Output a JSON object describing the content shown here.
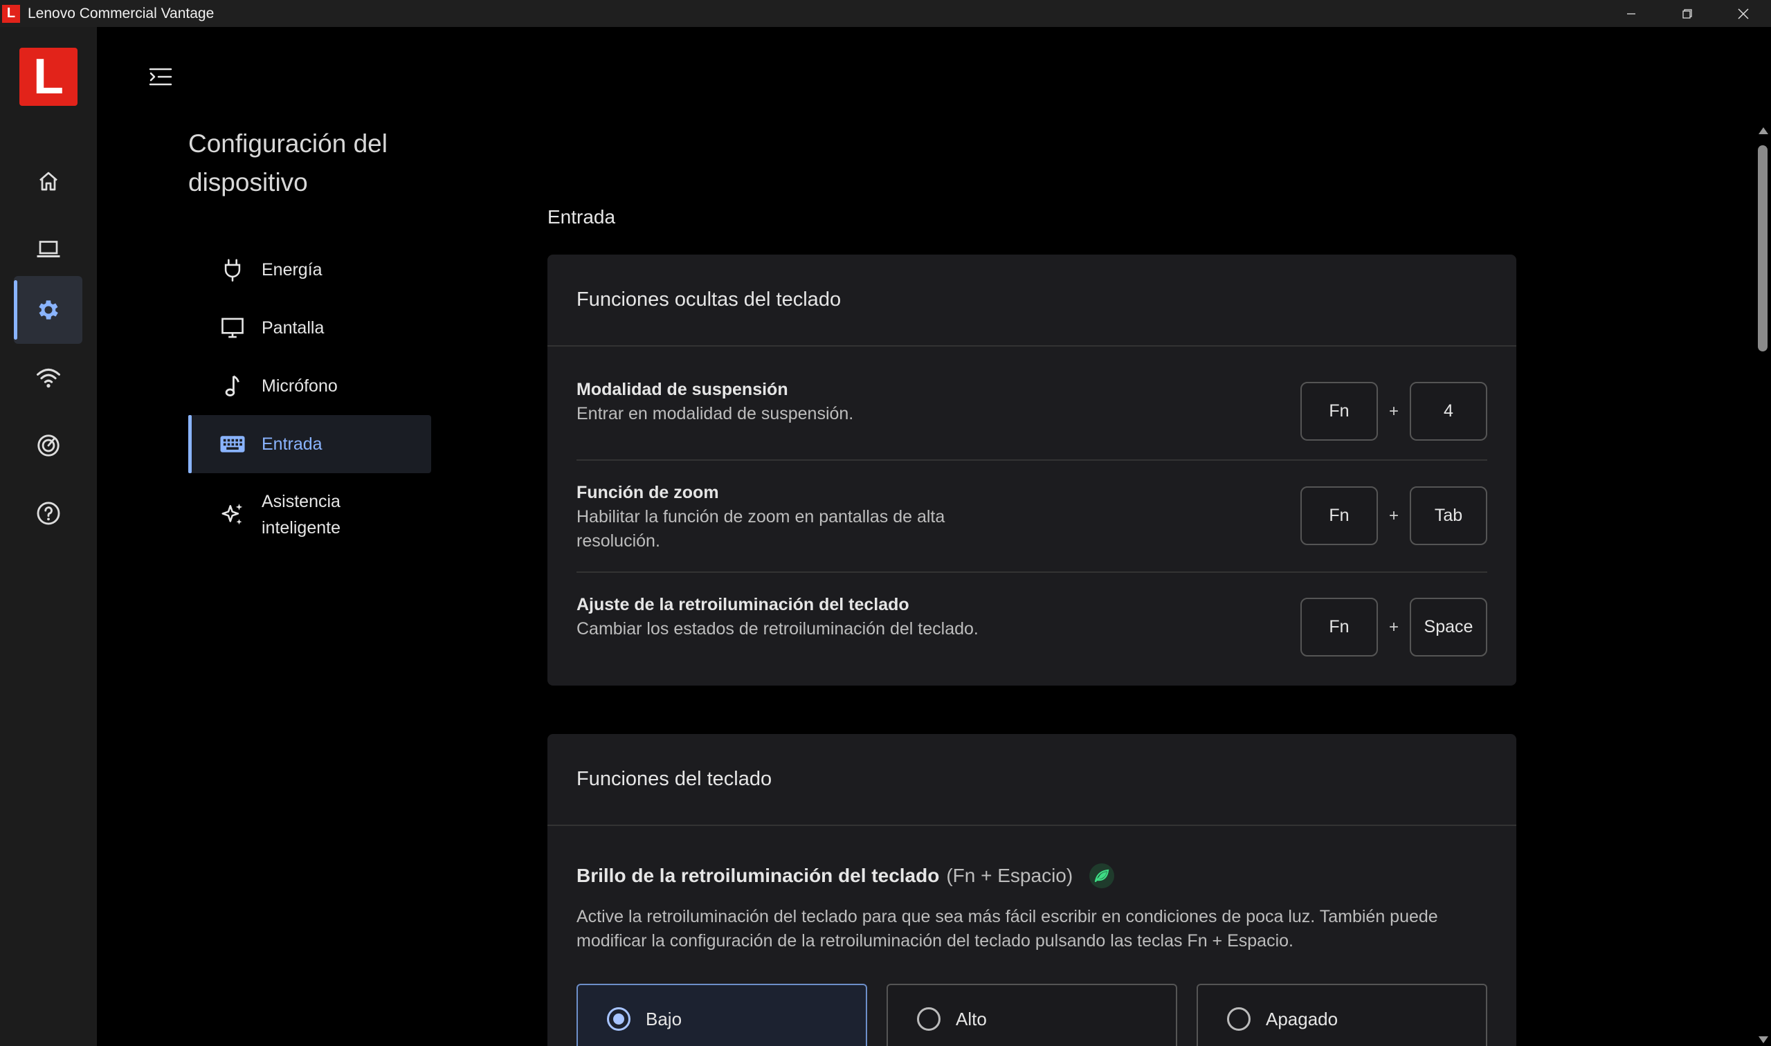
{
  "window": {
    "title": "Lenovo Commercial Vantage",
    "app_icon_letter": "L"
  },
  "rail": {
    "logo_letter": "L",
    "items": [
      {
        "icon": "home-icon"
      },
      {
        "icon": "laptop-icon"
      },
      {
        "icon": "gear-icon",
        "active": true
      },
      {
        "icon": "wifi-icon"
      },
      {
        "icon": "gauge-icon"
      },
      {
        "icon": "help-icon"
      }
    ]
  },
  "section": {
    "title": "Configuración del dispositivo"
  },
  "subnav": {
    "items": [
      {
        "label": "Energía",
        "icon": "plug-icon"
      },
      {
        "label": "Pantalla",
        "icon": "monitor-icon"
      },
      {
        "label": "Micrófono",
        "icon": "music-note-icon"
      },
      {
        "label": "Entrada",
        "icon": "keyboard-icon",
        "active": true
      },
      {
        "label": "Asistencia inteligente",
        "icon": "sparkle-icon"
      }
    ]
  },
  "main": {
    "heading": "Entrada",
    "hidden_functions": {
      "title": "Funciones ocultas del teclado",
      "rows": [
        {
          "title": "Modalidad de suspensión",
          "desc": "Entrar en modalidad de suspensión.",
          "key1": "Fn",
          "plus": "+",
          "key2": "4"
        },
        {
          "title": "Función de zoom",
          "desc": "Habilitar la función de zoom en pantallas de alta resolución.",
          "key1": "Fn",
          "plus": "+",
          "key2": "Tab"
        },
        {
          "title": "Ajuste de la retroiluminación del teclado",
          "desc": "Cambiar los estados de retroiluminación del teclado.",
          "key1": "Fn",
          "plus": "+",
          "key2": "Space"
        }
      ]
    },
    "keyboard_functions": {
      "title": "Funciones del teclado",
      "backlight_title": "Brillo de la retroiluminación del teclado",
      "backlight_shortcut": "(Fn + Espacio)",
      "backlight_desc": "Active la retroiluminación del teclado para que sea más fácil escribir en condiciones de poca luz. También puede modificar la configuración de la retroiluminación del teclado pulsando las teclas Fn + Espacio.",
      "options": [
        {
          "label": "Bajo",
          "selected": true
        },
        {
          "label": "Alto",
          "selected": false
        },
        {
          "label": "Apagado",
          "selected": false
        }
      ]
    }
  },
  "colors": {
    "accent": "#8ab4ff",
    "brand_red": "#e2231a",
    "eco_green": "#3ddc84"
  }
}
